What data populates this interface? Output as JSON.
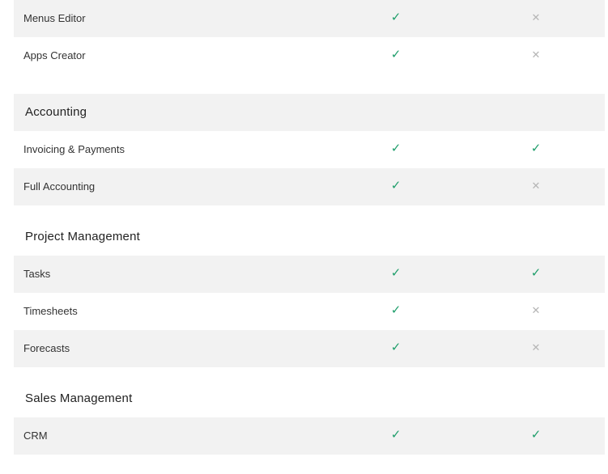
{
  "icons": {
    "yes": "✓",
    "no": "✕",
    "yes_name": "check-icon",
    "no_name": "cross-icon"
  },
  "colors": {
    "check": "#1f9e6b",
    "cross": "#b5b5b5",
    "row_shade": "#f2f2f2"
  },
  "top_rows": [
    {
      "label": "Menus Editor",
      "col1": "✓",
      "col2": "✕"
    },
    {
      "label": "Apps Creator",
      "col1": "✓",
      "col2": "✕"
    }
  ],
  "sections": [
    {
      "title": "Accounting",
      "rows": [
        {
          "label": "Invoicing & Payments",
          "col1": "✓",
          "col2": "✓"
        },
        {
          "label": "Full Accounting",
          "col1": "✓",
          "col2": "✕"
        }
      ]
    },
    {
      "title": "Project Management",
      "rows": [
        {
          "label": "Tasks",
          "col1": "✓",
          "col2": "✓"
        },
        {
          "label": "Timesheets",
          "col1": "✓",
          "col2": "✕"
        },
        {
          "label": "Forecasts",
          "col1": "✓",
          "col2": "✕"
        }
      ]
    },
    {
      "title": "Sales Management",
      "rows": [
        {
          "label": "CRM",
          "col1": "✓",
          "col2": "✓"
        }
      ]
    }
  ]
}
